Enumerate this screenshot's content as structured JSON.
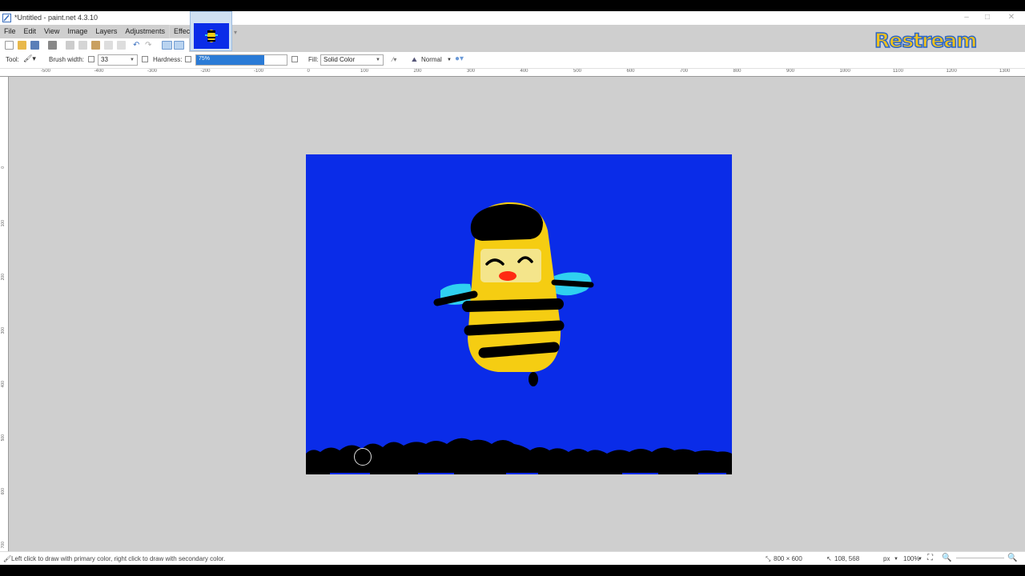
{
  "window": {
    "title": "*Untitled - paint.net 4.3.10"
  },
  "menu": [
    {
      "label": "File"
    },
    {
      "label": "Edit"
    },
    {
      "label": "View"
    },
    {
      "label": "Image"
    },
    {
      "label": "Layers"
    },
    {
      "label": "Adjustments"
    },
    {
      "label": "Effects"
    }
  ],
  "tool_options": {
    "tool_label": "Tool:",
    "brush_width_label": "Brush width:",
    "brush_width_value": "33",
    "hardness_label": "Hardness:",
    "hardness_value": "75%",
    "hardness_fraction": 0.75,
    "fill_label": "Fill:",
    "fill_value": "Solid Color",
    "blend_mode": "Normal"
  },
  "ruler": {
    "h_labels": [
      "-500",
      "-400",
      "-300",
      "-200",
      "-100",
      "0",
      "100",
      "200",
      "300",
      "400",
      "500",
      "600",
      "700",
      "800",
      "900",
      "1000",
      "1100",
      "1200",
      "1300"
    ],
    "v_labels": [
      "0",
      "100",
      "200",
      "300",
      "400",
      "500",
      "600",
      "700"
    ]
  },
  "status": {
    "hint": "Left click to draw with primary color, right click to draw with secondary color.",
    "image_size": "800 × 600",
    "cursor_pos": "108, 568",
    "units": "px",
    "zoom": "100%"
  },
  "watermark": {
    "text": "Restream"
  },
  "colors": {
    "canvas_bg": "#0a2ce8",
    "bee_yellow": "#f5cd12",
    "wing_cyan": "#2fd0f0",
    "black": "#000000",
    "mouth_red": "#ff2a12",
    "accent": "#2a7bd6"
  }
}
